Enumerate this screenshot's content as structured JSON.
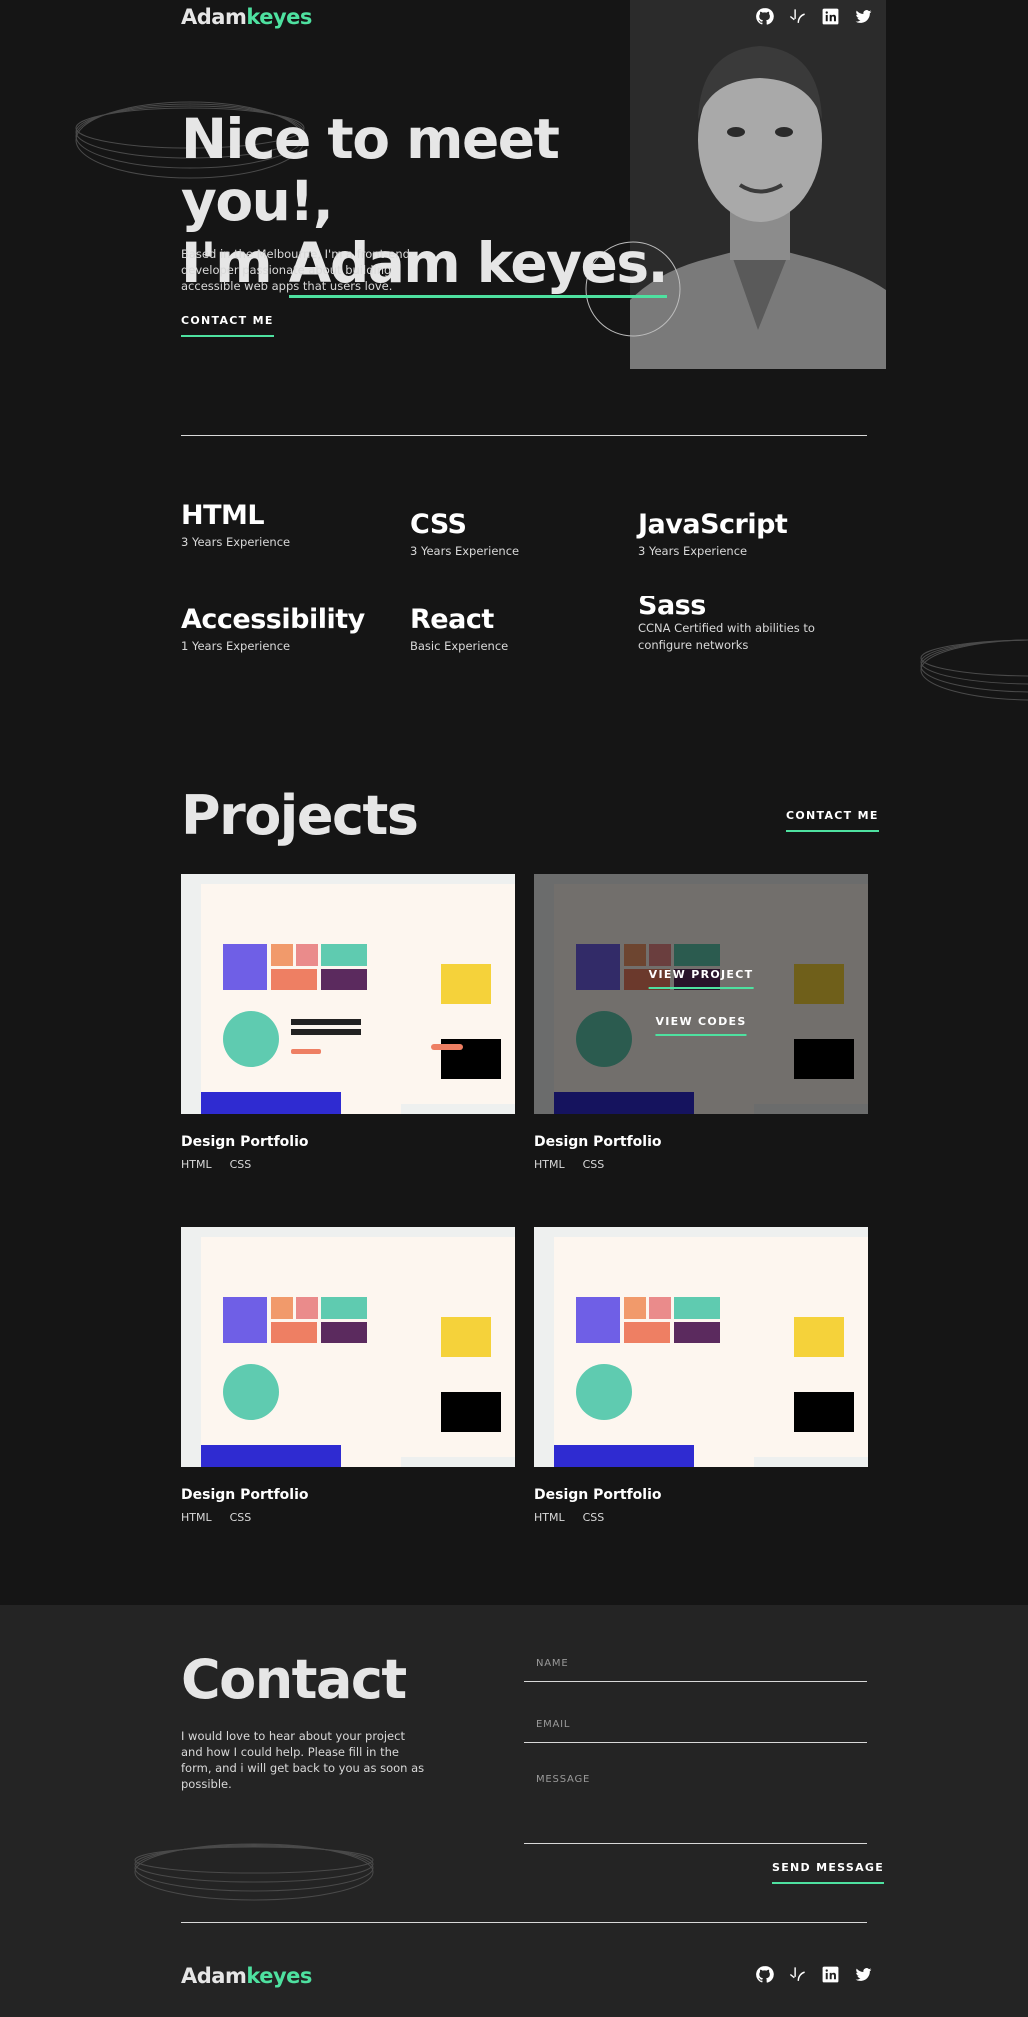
{
  "header": {
    "logo_first": "Adam",
    "logo_second": "keyes"
  },
  "socials": [
    {
      "icon": "github-icon"
    },
    {
      "icon": "frontend-mentor-icon"
    },
    {
      "icon": "linkedin-icon"
    },
    {
      "icon": "twitter-icon"
    }
  ],
  "hero": {
    "line1": "Nice to meet you!,",
    "line2_prefix": "I'm ",
    "line2_name": "Adam keyes.",
    "description": "Based in the Melbourne, I'm a front-end developer passionate about building accessible web apps that users love.",
    "cta": "CONTACT ME"
  },
  "skills": [
    {
      "name": "HTML",
      "experience": "3 Years Experience"
    },
    {
      "name": "CSS",
      "experience": "3 Years Experience"
    },
    {
      "name": "JavaScript",
      "experience": "3 Years Experience"
    },
    {
      "name": "Accessibility",
      "experience": "1 Years Experience"
    },
    {
      "name": "React",
      "experience": "Basic Experience"
    },
    {
      "name": "Sass",
      "experience": "CCNA Certified with abilities to configure networks"
    }
  ],
  "projects": {
    "title": "Projects",
    "cta": "CONTACT ME",
    "view_project": "VIEW PROJECT",
    "view_codes": "VIEW CODES",
    "items": [
      {
        "title": "Design Portfolio",
        "tags": [
          "HTML",
          "CSS"
        ]
      },
      {
        "title": "Design Portfolio",
        "tags": [
          "HTML",
          "CSS"
        ]
      },
      {
        "title": "Design Portfolio",
        "tags": [
          "HTML",
          "CSS"
        ]
      },
      {
        "title": "Design Portfolio",
        "tags": [
          "HTML",
          "CSS"
        ]
      }
    ]
  },
  "contact": {
    "title": "Contact",
    "description": "I would love to hear about your project and how I could help. Please fill in the form, and i will get back to you as soon as possible.",
    "name_placeholder": "NAME",
    "email_placeholder": "EMAIL",
    "message_placeholder": "MESSAGE",
    "submit": "SEND MESSAGE"
  },
  "footer": {
    "logo_first": "Adam",
    "logo_second": "keyes"
  },
  "colors": {
    "accent": "#4ee1a0",
    "background": "#151515",
    "contact_bg": "#242424"
  }
}
